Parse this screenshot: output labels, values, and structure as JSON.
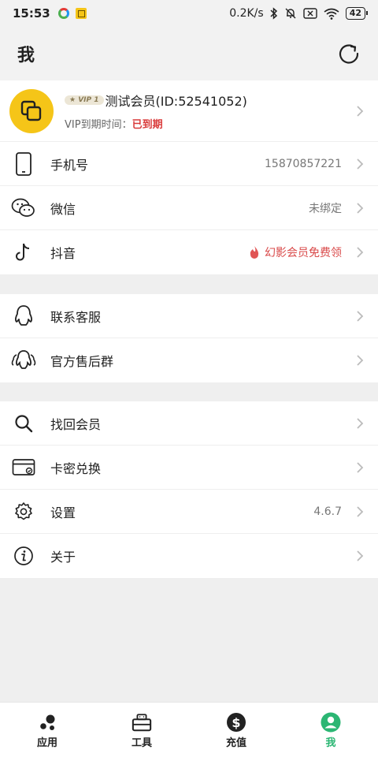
{
  "status_bar": {
    "time": "15:53",
    "net_speed": "0.2K/s",
    "battery": "42"
  },
  "header": {
    "title": "我"
  },
  "profile": {
    "vip_badge": "VIP 1",
    "name": "测试会员(ID:52541052)",
    "vip_expiry_label": "VIP到期时间：",
    "vip_expiry_value": "已到期"
  },
  "accounts": [
    {
      "label": "手机号",
      "value": "15870857221"
    },
    {
      "label": "微信",
      "value": "未绑定"
    },
    {
      "label": "抖音",
      "value": "幻影会员免费领"
    }
  ],
  "support": [
    {
      "label": "联系客服"
    },
    {
      "label": "官方售后群"
    }
  ],
  "misc": [
    {
      "label": "找回会员",
      "value": ""
    },
    {
      "label": "卡密兑换",
      "value": ""
    },
    {
      "label": "设置",
      "value": "4.6.7"
    },
    {
      "label": "关于",
      "value": ""
    }
  ],
  "tabs": [
    {
      "label": "应用",
      "icon": "apps-dots-icon"
    },
    {
      "label": "工具",
      "icon": "toolbox-icon"
    },
    {
      "label": "充值",
      "icon": "dollar-coin-icon"
    },
    {
      "label": "我",
      "icon": "user-avatar-icon",
      "active": true
    }
  ],
  "colors": {
    "accent_green": "#2bb673",
    "avatar_yellow": "#f5c518",
    "expired_red": "#d93a3a",
    "promo_red": "#d94a4a"
  }
}
